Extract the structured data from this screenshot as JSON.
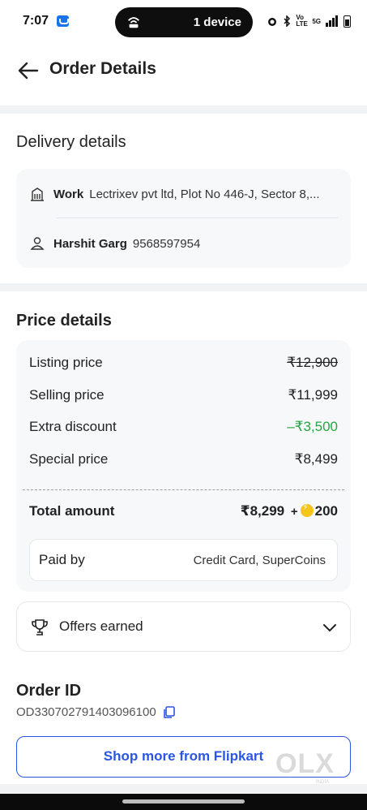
{
  "status_bar": {
    "time": "7:07",
    "pill_text": "1 device",
    "network": "Vo LTE",
    "signal": "5G"
  },
  "header": {
    "title": "Order Details"
  },
  "delivery": {
    "title": "Delivery details",
    "address_label": "Work",
    "address_text": "Lectrixev pvt ltd, Plot No 446-J, Sector 8,...",
    "contact_name": "Harshit Garg",
    "contact_phone": "9568597954"
  },
  "price": {
    "title": "Price details",
    "rows": [
      {
        "label": "Listing price",
        "value": "₹12,900"
      },
      {
        "label": "Selling price",
        "value": "₹11,999"
      },
      {
        "label": "Extra discount",
        "value": "–₹3,500"
      },
      {
        "label": "Special price",
        "value": "₹8,499"
      }
    ],
    "total_label": "Total amount",
    "total_value": "₹8,299",
    "total_plus": "+",
    "total_coins": "200",
    "paid_by_label": "Paid by",
    "paid_by_value": "Credit Card, SuperCoins"
  },
  "offers": {
    "label": "Offers earned"
  },
  "order": {
    "title": "Order ID",
    "id": "OD330702791403096100"
  },
  "cta": {
    "label": "Shop more from Flipkart"
  },
  "watermark": {
    "text": "OLX",
    "sub": "INDIA"
  },
  "colors": {
    "discount": "#26a541",
    "button": "#2a55e5",
    "band": "#f1f2f4"
  }
}
